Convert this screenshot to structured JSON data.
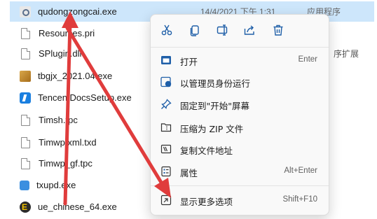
{
  "files": [
    {
      "name": "qudongzongcai.exe",
      "date": "14/4/2021 下午 1:31",
      "type": "应用程序",
      "icon": "gear-app-icon",
      "selected": true
    },
    {
      "name": "Resources.pri",
      "date": "",
      "type": "",
      "icon": "document-icon"
    },
    {
      "name": "SPlugin.dll",
      "date": "",
      "type": "",
      "extra": "序扩展",
      "icon": "document-icon"
    },
    {
      "name": "tbgjx_2021.04.exe",
      "date": "",
      "type": "",
      "icon": "package-icon"
    },
    {
      "name": "TencentDocsSetup.exe",
      "date": "",
      "type": "",
      "icon": "tencent-docs-icon"
    },
    {
      "name": "Timsh.tpc",
      "date": "",
      "type": "",
      "icon": "document-icon"
    },
    {
      "name": "Timwp.xml.txd",
      "date": "",
      "type": "",
      "icon": "document-icon"
    },
    {
      "name": "Timwp_gf.tpc",
      "date": "",
      "type": "",
      "icon": "document-icon"
    },
    {
      "name": "txupd.exe",
      "date": "",
      "type": "",
      "icon": "updater-icon"
    },
    {
      "name": "ue_chinese_64.exe",
      "date": "",
      "type": "",
      "icon": "ultraedit-icon"
    }
  ],
  "context_menu": {
    "quick_actions": [
      "cut-icon",
      "copy-icon",
      "rename-icon",
      "share-icon",
      "delete-icon"
    ],
    "items": [
      {
        "label": "打开",
        "shortcut": "Enter",
        "icon": "open-icon"
      },
      {
        "label": "以管理员身份运行",
        "shortcut": "",
        "icon": "admin-shield-icon"
      },
      {
        "label": "固定到\"开始\"屏幕",
        "shortcut": "",
        "icon": "pin-icon"
      },
      {
        "label": "压缩为 ZIP 文件",
        "shortcut": "",
        "icon": "zip-icon"
      },
      {
        "label": "复制文件地址",
        "shortcut": "",
        "icon": "copy-path-icon"
      },
      {
        "label": "属性",
        "shortcut": "Alt+Enter",
        "icon": "properties-icon"
      },
      {
        "label": "显示更多选项",
        "shortcut": "Shift+F10",
        "icon": "more-options-icon"
      }
    ]
  },
  "colors": {
    "selection": "#cde6fb",
    "accent": "#1f5fa8",
    "arrow": "#e03c3c"
  }
}
